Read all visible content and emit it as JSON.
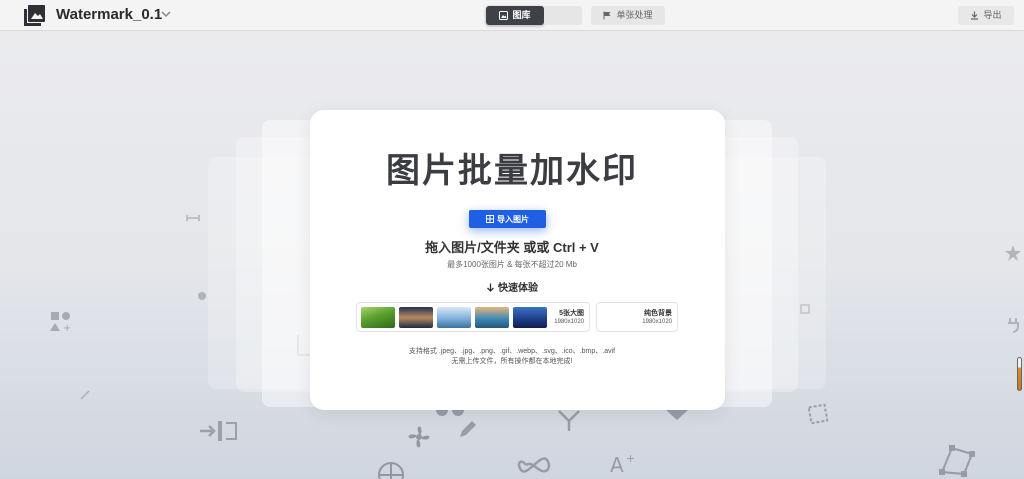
{
  "header": {
    "app_title": "Watermark_0.1",
    "tabs": [
      {
        "label": "图库",
        "icon": "image-icon",
        "active": true
      },
      {
        "label": "单张处理",
        "icon": "flag-icon",
        "active": false
      }
    ],
    "export_label": "导出"
  },
  "main": {
    "headline": "图片批量加水印",
    "import_button": "导入图片",
    "drop_hint": "拖入图片/文件夹 或或 Ctrl + V",
    "limit_hint": "最多1000张图片 & 每张不超过20 Mb",
    "quick_title": "快速体验",
    "samples": [
      {
        "name": "5张大图",
        "size": "1980x1020"
      },
      {
        "name": "纯色背景",
        "size": "1980x1020"
      }
    ],
    "formats": "支持格式 .jpeg、.jpg、.png、.gif、.webp、.svg、.ico、.bmp、.avif",
    "privacy": "无需上传文件，所有操作都在本地完成!"
  },
  "colors": {
    "accent": "#1f5fe3",
    "active_tab": "#3e4148",
    "headline": "#3b3d42"
  }
}
